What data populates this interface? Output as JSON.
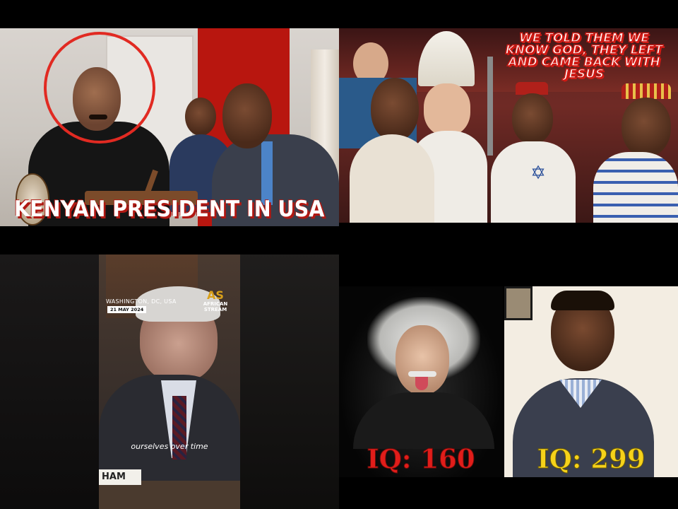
{
  "tiles": {
    "t1": {
      "banner": "KENYAN PRESIDENT IN USA"
    },
    "t2": {
      "caption": "WE TOLD THEM WE KNOW GOD, THEY LEFT AND CAME BACK WITH JESUS"
    },
    "t3": {
      "location": "WASHINGTON, DC, USA",
      "date": "21 MAY 2024",
      "logo_text": "AFRICAN STREAM",
      "logo_mark": "AS",
      "subtitle": "ourselves over time",
      "nameplate": "HAM"
    },
    "t4": {
      "left_label": "IQ: 160",
      "right_label": "IQ: 299"
    }
  },
  "colors": {
    "accent_red": "#e12a22",
    "iq_red": "#e11d1a",
    "iq_yellow": "#f6d21a",
    "background": "#000000"
  }
}
